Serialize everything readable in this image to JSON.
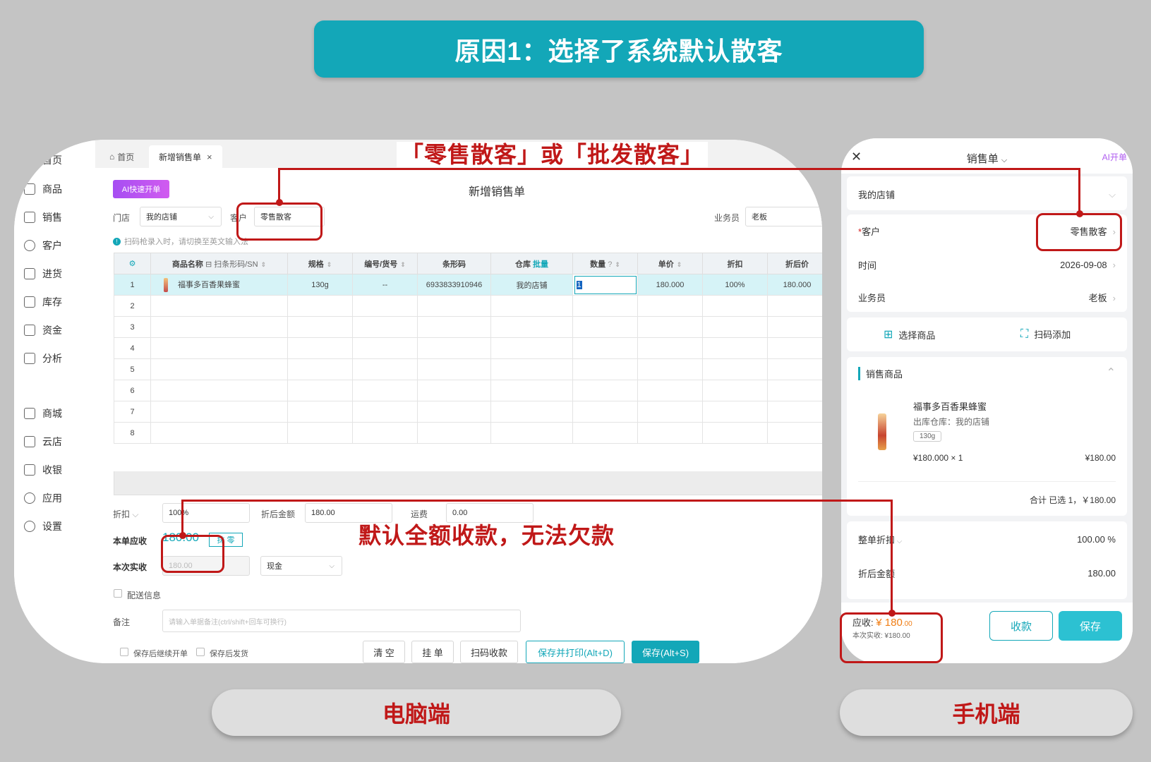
{
  "banner": {
    "title": "原因1：选择了系统默认散客"
  },
  "desktop": {
    "sidebar": [
      {
        "label": "首页",
        "icon": "home-icon"
      },
      {
        "label": "商品",
        "icon": "box-icon"
      },
      {
        "label": "销售",
        "icon": "receipt-icon"
      },
      {
        "label": "客户",
        "icon": "user-icon"
      },
      {
        "label": "进货",
        "icon": "inbound-icon"
      },
      {
        "label": "库存",
        "icon": "warehouse-icon"
      },
      {
        "label": "资金",
        "icon": "wallet-icon"
      },
      {
        "label": "分析",
        "icon": "chart-icon"
      },
      {
        "label": "商城",
        "icon": "store-icon"
      },
      {
        "label": "云店",
        "icon": "cloud-store-icon"
      },
      {
        "label": "收银",
        "icon": "cashier-icon"
      },
      {
        "label": "应用",
        "icon": "apps-icon"
      },
      {
        "label": "设置",
        "icon": "gear-icon"
      }
    ],
    "tabs": {
      "home": "首页",
      "active": "新增销售单",
      "close": "×"
    },
    "ai_button": "AI快速开单",
    "form_title": "新增销售单",
    "store_label": "门店",
    "store_value": "我的店铺",
    "customer_label": "客户",
    "customer_value": "零售散客",
    "salesman_label": "业务员",
    "salesman_value": "老板",
    "hint": "扫码枪录入时，请切换至英文输入法",
    "columns": [
      "",
      "商品名称",
      "规格",
      "编号/货号",
      "条形码",
      "仓库",
      "数量",
      "单价",
      "折扣",
      "折后价"
    ],
    "scan_col_suffix": "扫条形码/SN",
    "batch_label": "批量",
    "row1": {
      "no": "1",
      "name": "福事多百香果蜂蜜",
      "spec": "130g",
      "code": "--",
      "barcode": "6933833910946",
      "warehouse": "我的店铺",
      "qty": "1",
      "price": "180.000",
      "discount": "100%",
      "final": "180.000"
    },
    "row_numbers": [
      "2",
      "3",
      "4",
      "5",
      "6",
      "7",
      "8"
    ],
    "discount_label": "折扣",
    "discount_value": "100%",
    "after_discount_label": "折后金额",
    "after_discount_value": "180.00",
    "freight_label": "运费",
    "freight_value": "0.00",
    "receivable_label": "本单应收",
    "receivable_value": "180.00",
    "round_btn": "抹 零",
    "received_label": "本次实收",
    "received_value": "180.00",
    "pay_method": "现金",
    "delivery_label": "配送信息",
    "remark_label": "备注",
    "remark_placeholder": "请输入单据备注(ctrl/shift+回车可换行)",
    "continue_label": "保存后继续开单",
    "ship_label": "保存后发货",
    "buttons": {
      "clear": "清 空",
      "hold": "挂 单",
      "scan_pay": "扫码收款",
      "save_print": "保存并打印(Alt+D)",
      "save": "保存(Alt+S)"
    }
  },
  "phone": {
    "title": "销售单",
    "ai": "AI开单",
    "store": "我的店铺",
    "customer_label": "客户",
    "customer_value": "零售散客",
    "time_label": "时间",
    "time_value": "2026-09-08",
    "salesman_label": "业务员",
    "salesman_value": "老板",
    "select_goods": "选择商品",
    "scan_add": "扫码添加",
    "section": "销售商品",
    "product": {
      "name": "福事多百香果蜂蜜",
      "warehouse": "出库仓库：我的店铺",
      "spec": "130g",
      "price_qty": "¥180.000 × 1",
      "subtotal": "¥180.00"
    },
    "total": "合计 已选 1，￥180.00",
    "whole_discount_label": "整单折扣",
    "whole_discount_value": "100.00 %",
    "after_amount_label": "折后金额",
    "after_amount_value": "180.00",
    "receivable_label": "应收:",
    "receivable_value": "¥ 180",
    "receivable_decimal": ".00",
    "received": "本次实收: ¥180.00",
    "btn_collect": "收款",
    "btn_save": "保存"
  },
  "annotations": {
    "top": "「零售散客」或「批发散客」",
    "middle": "默认全额收款，无法欠款"
  },
  "labels": {
    "desktop": "电脑端",
    "mobile": "手机端"
  },
  "colors": {
    "accent": "#13a7b8",
    "highlight": "#c01818",
    "ai_purple": "#b05ef0"
  }
}
